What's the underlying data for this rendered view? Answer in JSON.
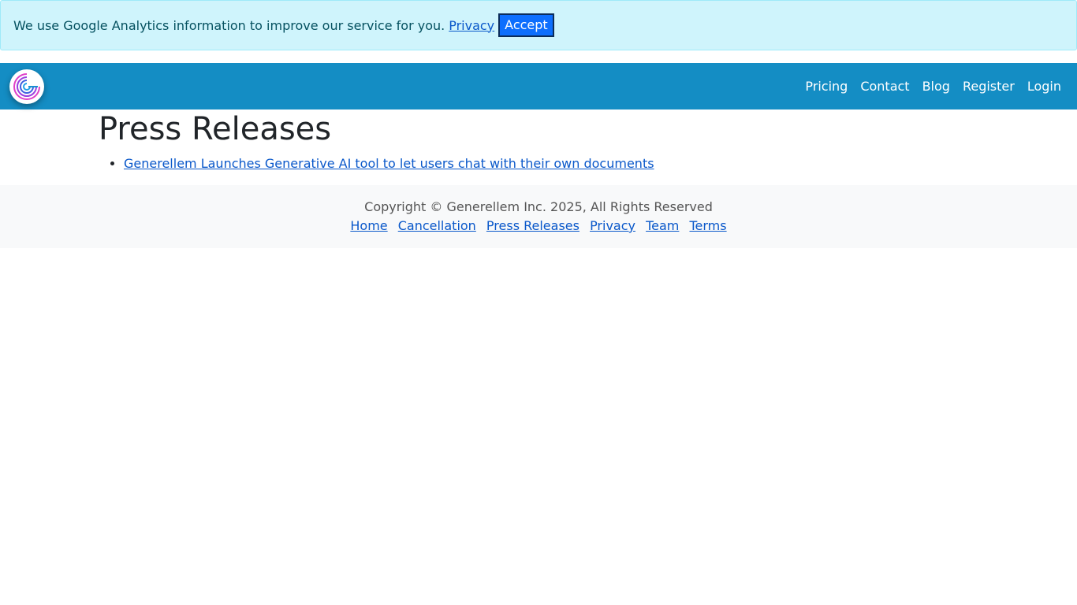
{
  "cookie_banner": {
    "message": "We use Google Analytics information to improve our service for you.",
    "privacy_link": "Privacy",
    "accept_label": "Accept"
  },
  "navbar": {
    "logo_icon": "generellem-logo-icon",
    "links": [
      "Pricing",
      "Contact",
      "Blog",
      "Register",
      "Login"
    ]
  },
  "main": {
    "title": "Press Releases",
    "releases": [
      "Generellem Launches Generative AI tool to let users chat with their own documents"
    ]
  },
  "footer": {
    "copyright": "Copyright © Generellem Inc. 2025, All Rights Reserved",
    "links": [
      "Home",
      "Cancellation",
      "Press Releases",
      "Privacy",
      "Team",
      "Terms"
    ]
  },
  "colors": {
    "navbar": "#148dc4",
    "banner_bg": "#cff4fc",
    "accept_button": "#0d6efd",
    "link": "#0a58ca"
  }
}
